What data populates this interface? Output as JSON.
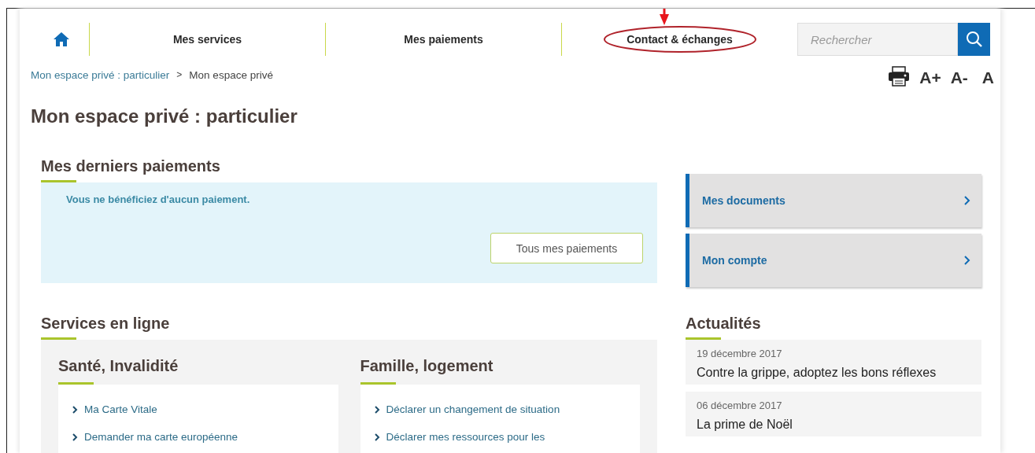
{
  "nav": {
    "items": [
      {
        "label": "Mes services",
        "circled": false
      },
      {
        "label": "Mes paiements",
        "circled": false
      },
      {
        "label": "Contact & échanges",
        "circled": true
      }
    ],
    "search": {
      "placeholder": "Rechercher"
    }
  },
  "breadcrumb": [
    {
      "label": "Mon espace privé : particulier",
      "link": true
    },
    {
      "label": "Mon espace privé",
      "link": false
    }
  ],
  "breadcrumb_separator": ">",
  "text_tools": [
    "A+",
    "A-",
    "A"
  ],
  "page_title": "Mon espace privé : particulier",
  "payments": {
    "title": "Mes derniers paiements",
    "message": "Vous ne bénéficiez d'aucun paiement.",
    "button": "Tous mes paiements"
  },
  "shortcuts": [
    {
      "label": "Mes documents"
    },
    {
      "label": "Mon compte"
    }
  ],
  "services": {
    "title": "Services en ligne",
    "groups": [
      {
        "title": "Santé, Invalidité",
        "links": [
          "Ma Carte Vitale",
          "Demander ma carte européenne"
        ]
      },
      {
        "title": "Famille, logement",
        "links": [
          "Déclarer un changement de situation",
          "Déclarer mes ressources pour les"
        ]
      }
    ]
  },
  "news": {
    "title": "Actualités",
    "items": [
      {
        "date": "19 décembre 2017",
        "title": "Contre la grippe, adoptez les bons réflexes"
      },
      {
        "date": "06 décembre 2017",
        "title": "La prime de Noël"
      }
    ]
  }
}
